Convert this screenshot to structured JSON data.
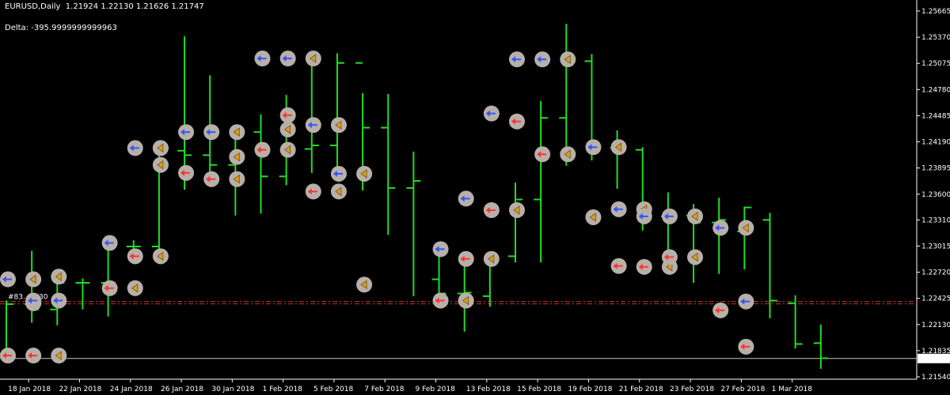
{
  "header": {
    "symbol_line": "EURUSD,Daily  1.21924 1.22130 1.21626 1.21747",
    "delta_line": "Delta: -395.9999999999963"
  },
  "colors": {
    "background": "#000000",
    "bar": "#22dd22",
    "axis": "#ffffff",
    "buy_arrow": "#3355ff",
    "sell_arrow": "#ff3333",
    "marker": "#b8b0a8",
    "buy_trace": "#2233cc",
    "sell_trace": "#cc2222",
    "level_line": "#cc3333"
  },
  "chart_data": {
    "type": "ohlc",
    "title": "EURUSD,Daily",
    "x_tick_labels": [
      "18 Jan 2018",
      "22 Jan 2018",
      "24 Jan 2018",
      "26 Jan 2018",
      "30 Jan 2018",
      "1 Feb 2018",
      "5 Feb 2018",
      "7 Feb 2018",
      "9 Feb 2018",
      "13 Feb 2018",
      "15 Feb 2018",
      "19 Feb 2018",
      "21 Feb 2018",
      "23 Feb 2018",
      "27 Feb 2018",
      "1 Mar 2018"
    ],
    "y_tick_labels": [
      "1.25665",
      "1.25370",
      "1.25075",
      "1.24780",
      "1.24485",
      "1.24190",
      "1.23895",
      "1.23600",
      "1.23310",
      "1.23015",
      "1.22720",
      "1.22425",
      "1.22130",
      "1.21835",
      "1.21540"
    ],
    "ylim": [
      1.2154,
      1.25665
    ],
    "current_price_label": "1.21747",
    "current_price": 1.21747,
    "level_annotation": "#83... 0.30",
    "level_price": 1.2239,
    "grid": false,
    "bars": [
      {
        "date": "17 Jan 2018",
        "o": 1.218,
        "h": 1.224,
        "l": 1.217,
        "c": 1.2236
      },
      {
        "date": "18 Jan 2018",
        "o": 1.2236,
        "h": 1.2296,
        "l": 1.2215,
        "c": 1.223
      },
      {
        "date": "19 Jan 2018",
        "o": 1.223,
        "h": 1.2275,
        "l": 1.2212,
        "c": 1.226
      },
      {
        "date": "22 Jan 2018",
        "o": 1.226,
        "h": 1.2265,
        "l": 1.223,
        "c": 1.226
      },
      {
        "date": "23 Jan 2018",
        "o": 1.226,
        "h": 1.231,
        "l": 1.2222,
        "c": 1.2301
      },
      {
        "date": "24 Jan 2018",
        "o": 1.2301,
        "h": 1.2308,
        "l": 1.2296,
        "c": 1.2301
      },
      {
        "date": "25 Jan 2018",
        "o": 1.2301,
        "h": 1.2412,
        "l": 1.2298,
        "c": 1.2409
      },
      {
        "date": "26 Jan 2018",
        "o": 1.2409,
        "h": 1.2538,
        "l": 1.2365,
        "c": 1.2404
      },
      {
        "date": "29 Jan 2018",
        "o": 1.2404,
        "h": 1.2494,
        "l": 1.237,
        "c": 1.2393
      },
      {
        "date": "30 Jan 2018",
        "o": 1.2393,
        "h": 1.2434,
        "l": 1.2336,
        "c": 1.243
      },
      {
        "date": "31 Jan 2018",
        "o": 1.243,
        "h": 1.245,
        "l": 1.2338,
        "c": 1.238
      },
      {
        "date": "1 Feb 2018",
        "o": 1.238,
        "h": 1.2472,
        "l": 1.237,
        "c": 1.2411
      },
      {
        "date": "2 Feb 2018",
        "o": 1.2411,
        "h": 1.252,
        "l": 1.2384,
        "c": 1.2415
      },
      {
        "date": "5 Feb 2018",
        "o": 1.2415,
        "h": 1.2519,
        "l": 1.2386,
        "c": 1.2508
      },
      {
        "date": "6 Feb 2018",
        "o": 1.2508,
        "h": 1.2474,
        "l": 1.2364,
        "c": 1.2435
      },
      {
        "date": "7 Feb 2018",
        "o": 1.2435,
        "h": 1.2473,
        "l": 1.2314,
        "c": 1.2367
      },
      {
        "date": "8 Feb 2018",
        "o": 1.2367,
        "h": 1.2408,
        "l": 1.2245,
        "c": 1.2375
      },
      {
        "date": "9 Feb 2018",
        "o": 1.2264,
        "h": 1.2293,
        "l": 1.2238,
        "c": 1.2248
      },
      {
        "date": "12 Feb 2018",
        "o": 1.2248,
        "h": 1.2288,
        "l": 1.2205,
        "c": 1.2249
      },
      {
        "date": "13 Feb 2018",
        "o": 1.2245,
        "h": 1.2295,
        "l": 1.2233,
        "c": 1.2292
      },
      {
        "date": "14 Feb 2018",
        "o": 1.229,
        "h": 1.2373,
        "l": 1.2283,
        "c": 1.2354
      },
      {
        "date": "15 Feb 2018",
        "o": 1.2354,
        "h": 1.2465,
        "l": 1.2283,
        "c": 1.2446
      },
      {
        "date": "16 Feb 2018",
        "o": 1.2446,
        "h": 1.2552,
        "l": 1.2392,
        "c": 1.251
      },
      {
        "date": "19 Feb 2018",
        "o": 1.251,
        "h": 1.2518,
        "l": 1.2398,
        "c": 1.2412
      },
      {
        "date": "20 Feb 2018",
        "o": 1.2412,
        "h": 1.2432,
        "l": 1.2366,
        "c": 1.241
      },
      {
        "date": "21 Feb 2018",
        "o": 1.241,
        "h": 1.2413,
        "l": 1.2319,
        "c": 1.2335
      },
      {
        "date": "22 Feb 2018",
        "o": 1.2335,
        "h": 1.2362,
        "l": 1.2287,
        "c": 1.2336
      },
      {
        "date": "23 Feb 2018",
        "o": 1.2336,
        "h": 1.2349,
        "l": 1.226,
        "c": 1.2328
      },
      {
        "date": "26 Feb 2018",
        "o": 1.2328,
        "h": 1.2356,
        "l": 1.227,
        "c": 1.2331
      },
      {
        "date": "27 Feb 2018",
        "o": 1.2318,
        "h": 1.2346,
        "l": 1.2275,
        "c": 1.2345
      },
      {
        "date": "28 Feb 2018",
        "o": 1.2331,
        "h": 1.2339,
        "l": 1.222,
        "c": 1.224
      },
      {
        "date": "1 Mar 2018",
        "o": 1.2237,
        "h": 1.2246,
        "l": 1.2186,
        "c": 1.2191
      },
      {
        "date": "2 Mar 2018",
        "o": 1.2192,
        "h": 1.2213,
        "l": 1.2163,
        "c": 1.2175
      }
    ],
    "trade_markers": [
      {
        "bar": 0,
        "price": 1.2264,
        "dir": "buy"
      },
      {
        "bar": 1,
        "price": 1.2264,
        "dir": "close"
      },
      {
        "bar": 0,
        "price": 1.2178,
        "dir": "sell"
      },
      {
        "bar": 1,
        "price": 1.2178,
        "dir": "sell"
      },
      {
        "bar": 2,
        "price": 1.2178,
        "dir": "close"
      },
      {
        "bar": 1,
        "price": 1.2237,
        "dir": "sell"
      },
      {
        "bar": 1,
        "price": 1.224,
        "dir": "buy"
      },
      {
        "bar": 2,
        "price": 1.224,
        "dir": "buy"
      },
      {
        "bar": 2,
        "price": 1.2267,
        "dir": "close"
      },
      {
        "bar": 4,
        "price": 1.2305,
        "dir": "buy"
      },
      {
        "bar": 4,
        "price": 1.2254,
        "dir": "sell"
      },
      {
        "bar": 5,
        "price": 1.2254,
        "dir": "close"
      },
      {
        "bar": 5,
        "price": 1.229,
        "dir": "sell"
      },
      {
        "bar": 6,
        "price": 1.229,
        "dir": "close"
      },
      {
        "bar": 5,
        "price": 1.2412,
        "dir": "buy"
      },
      {
        "bar": 6,
        "price": 1.2412,
        "dir": "buy"
      },
      {
        "bar": 6,
        "price": 1.2412,
        "dir": "close"
      },
      {
        "bar": 6,
        "price": 1.2393,
        "dir": "close"
      },
      {
        "bar": 7,
        "price": 1.243,
        "dir": "buy"
      },
      {
        "bar": 8,
        "price": 1.243,
        "dir": "buy"
      },
      {
        "bar": 9,
        "price": 1.243,
        "dir": "close"
      },
      {
        "bar": 7,
        "price": 1.2384,
        "dir": "sell"
      },
      {
        "bar": 8,
        "price": 1.2377,
        "dir": "sell"
      },
      {
        "bar": 9,
        "price": 1.2377,
        "dir": "close"
      },
      {
        "bar": 9,
        "price": 1.2402,
        "dir": "close"
      },
      {
        "bar": 10,
        "price": 1.241,
        "dir": "sell"
      },
      {
        "bar": 11,
        "price": 1.241,
        "dir": "close"
      },
      {
        "bar": 10,
        "price": 1.2513,
        "dir": "buy"
      },
      {
        "bar": 11,
        "price": 1.2513,
        "dir": "buy"
      },
      {
        "bar": 12,
        "price": 1.2513,
        "dir": "close"
      },
      {
        "bar": 11,
        "price": 1.2449,
        "dir": "sell"
      },
      {
        "bar": 11,
        "price": 1.2433,
        "dir": "close"
      },
      {
        "bar": 12,
        "price": 1.2438,
        "dir": "buy"
      },
      {
        "bar": 13,
        "price": 1.2438,
        "dir": "close"
      },
      {
        "bar": 12,
        "price": 1.2363,
        "dir": "sell"
      },
      {
        "bar": 13,
        "price": 1.2363,
        "dir": "close"
      },
      {
        "bar": 13,
        "price": 1.2383,
        "dir": "buy"
      },
      {
        "bar": 14,
        "price": 1.2383,
        "dir": "close"
      },
      {
        "bar": 14,
        "price": 1.2258,
        "dir": "close"
      },
      {
        "bar": 17,
        "price": 1.224,
        "dir": "sell"
      },
      {
        "bar": 18,
        "price": 1.224,
        "dir": "close"
      },
      {
        "bar": 17,
        "price": 1.2298,
        "dir": "buy"
      },
      {
        "bar": 18,
        "price": 1.2355,
        "dir": "buy"
      },
      {
        "bar": 18,
        "price": 1.2287,
        "dir": "sell"
      },
      {
        "bar": 19,
        "price": 1.2287,
        "dir": "close"
      },
      {
        "bar": 19,
        "price": 1.2342,
        "dir": "sell"
      },
      {
        "bar": 20,
        "price": 1.2342,
        "dir": "close"
      },
      {
        "bar": 19,
        "price": 1.2451,
        "dir": "buy"
      },
      {
        "bar": 20,
        "price": 1.2442,
        "dir": "sell"
      },
      {
        "bar": 20,
        "price": 1.2512,
        "dir": "buy"
      },
      {
        "bar": 21,
        "price": 1.2512,
        "dir": "buy"
      },
      {
        "bar": 22,
        "price": 1.2512,
        "dir": "close"
      },
      {
        "bar": 21,
        "price": 1.2405,
        "dir": "sell"
      },
      {
        "bar": 22,
        "price": 1.2405,
        "dir": "close"
      },
      {
        "bar": 23,
        "price": 1.2413,
        "dir": "buy"
      },
      {
        "bar": 24,
        "price": 1.2413,
        "dir": "close"
      },
      {
        "bar": 23,
        "price": 1.2334,
        "dir": "close"
      },
      {
        "bar": 24,
        "price": 1.2343,
        "dir": "buy"
      },
      {
        "bar": 25,
        "price": 1.2343,
        "dir": "close"
      },
      {
        "bar": 24,
        "price": 1.2279,
        "dir": "sell"
      },
      {
        "bar": 25,
        "price": 1.2278,
        "dir": "sell"
      },
      {
        "bar": 26,
        "price": 1.2278,
        "dir": "close"
      },
      {
        "bar": 25,
        "price": 1.2335,
        "dir": "buy"
      },
      {
        "bar": 26,
        "price": 1.2335,
        "dir": "buy"
      },
      {
        "bar": 27,
        "price": 1.2335,
        "dir": "close"
      },
      {
        "bar": 26,
        "price": 1.2289,
        "dir": "sell"
      },
      {
        "bar": 27,
        "price": 1.2289,
        "dir": "close"
      },
      {
        "bar": 28,
        "price": 1.2322,
        "dir": "buy"
      },
      {
        "bar": 29,
        "price": 1.2322,
        "dir": "close"
      },
      {
        "bar": 28,
        "price": 1.2229,
        "dir": "sell"
      },
      {
        "bar": 29,
        "price": 1.2239,
        "dir": "buy"
      },
      {
        "bar": 29,
        "price": 1.2188,
        "dir": "sell"
      }
    ]
  }
}
